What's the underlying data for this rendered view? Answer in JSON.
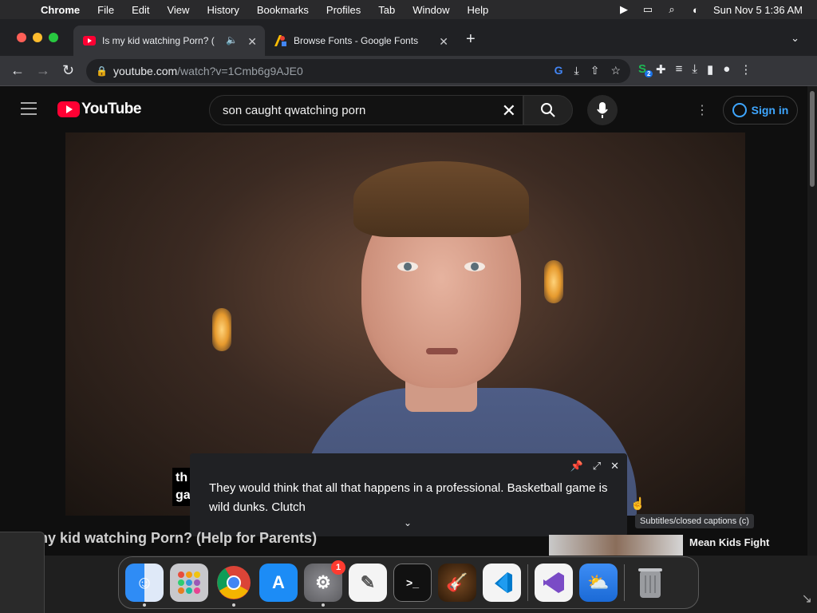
{
  "menubar": {
    "app": "Chrome",
    "items": [
      "File",
      "Edit",
      "View",
      "History",
      "Bookmarks",
      "Profiles",
      "Tab",
      "Window",
      "Help"
    ],
    "datetime": "Sun Nov 5  1:36 AM"
  },
  "tabs": [
    {
      "title": "Is my kid watching Porn? (",
      "active": true
    },
    {
      "title": "Browse Fonts - Google Fonts",
      "active": false
    }
  ],
  "address": {
    "host": "youtube.com",
    "path": "/watch?v=1Cmb6g9AJE0"
  },
  "extensions": {
    "badge": "2"
  },
  "youtube": {
    "logo": "YouTube",
    "search_query": "son caught qwatching porn",
    "sign_in": "Sign in",
    "video_title": "Is my kid watching Porn? (Help for Parents)",
    "bg_caption": [
      "th",
      "ga"
    ],
    "caption_panel_text": "They would think that all that happens in a professional. Basketball game is wild dunks. Clutch",
    "tooltip": "Subtitles/closed captions (c)",
    "next_video_title": "Mean Kids Fight"
  },
  "dock": {
    "settings_badge": "1"
  },
  "colors": {
    "youtube_red": "#ff0033",
    "link_blue": "#3ea6ff"
  }
}
